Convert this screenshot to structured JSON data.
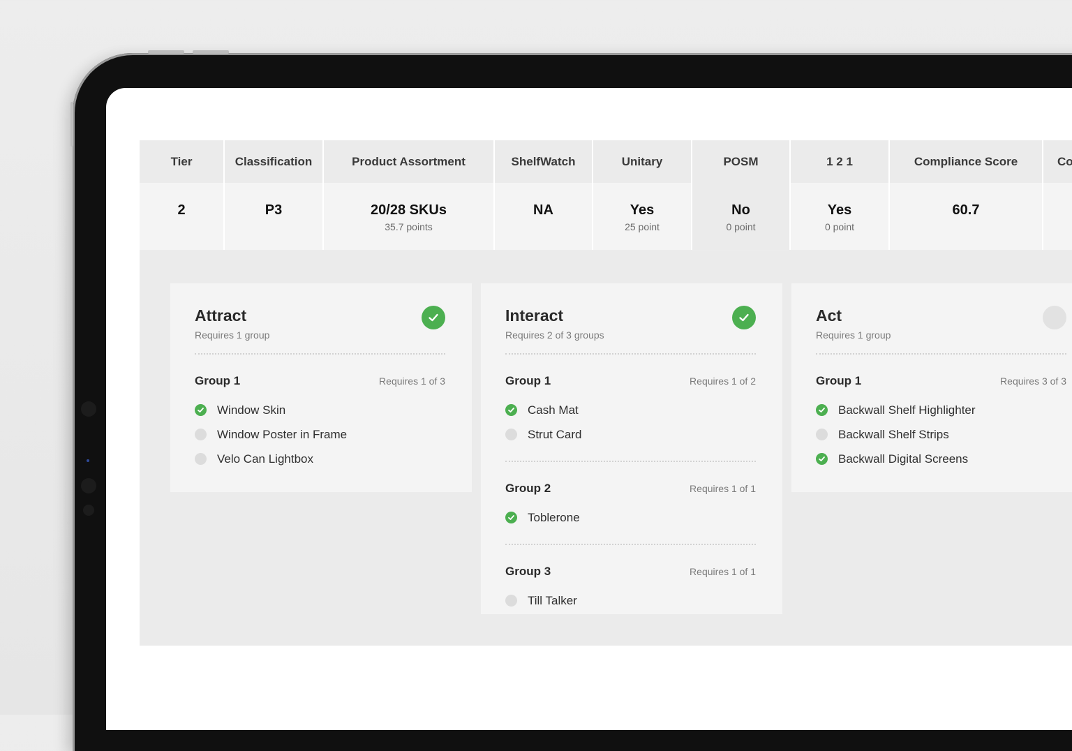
{
  "summary": {
    "headers": [
      "Tier",
      "Classification",
      "Product Assortment",
      "ShelfWatch",
      "Unitary",
      "POSM",
      "1 2 1",
      "Compliance Score",
      "Co"
    ],
    "values": [
      {
        "main": "2",
        "sub": ""
      },
      {
        "main": "P3",
        "sub": ""
      },
      {
        "main": "20/28 SKUs",
        "sub": "35.7 points"
      },
      {
        "main": "NA",
        "sub": ""
      },
      {
        "main": "Yes",
        "sub": "25 point"
      },
      {
        "main": "No",
        "sub": "0 point"
      },
      {
        "main": "Yes",
        "sub": "0 point"
      },
      {
        "main": "60.7",
        "sub": ""
      },
      {
        "main": "",
        "sub": ""
      }
    ],
    "active_column": "POSM"
  },
  "cards": {
    "attract": {
      "title": "Attract",
      "subtitle": "Requires 1 group",
      "status": "complete",
      "groups": [
        {
          "title": "Group 1",
          "requirement": "Requires 1 of 3",
          "items": [
            {
              "label": "Window Skin",
              "done": true
            },
            {
              "label": "Window Poster in Frame",
              "done": false
            },
            {
              "label": "Velo Can Lightbox",
              "done": false
            }
          ]
        }
      ]
    },
    "interact": {
      "title": "Interact",
      "subtitle": "Requires 2 of 3 groups",
      "status": "complete",
      "groups": [
        {
          "title": "Group 1",
          "requirement": "Requires 1 of 2",
          "items": [
            {
              "label": "Cash Mat",
              "done": true
            },
            {
              "label": "Strut Card",
              "done": false
            }
          ]
        },
        {
          "title": "Group 2",
          "requirement": "Requires 1 of 1",
          "items": [
            {
              "label": "Toblerone",
              "done": true
            }
          ]
        },
        {
          "title": "Group 3",
          "requirement": "Requires 1 of 1",
          "items": [
            {
              "label": "Till Talker",
              "done": false
            }
          ]
        }
      ]
    },
    "act": {
      "title": "Act",
      "subtitle": "Requires 1 group",
      "status": "incomplete",
      "groups": [
        {
          "title": "Group 1",
          "requirement": "Requires 3 of 3",
          "items": [
            {
              "label": "Backwall Shelf Highlighter",
              "done": true
            },
            {
              "label": "Backwall Shelf Strips",
              "done": false
            },
            {
              "label": "Backwall Digital Screens",
              "done": true
            }
          ]
        }
      ]
    }
  },
  "colors": {
    "success": "#4caf50",
    "pending": "#dcdcdc",
    "header_bg": "#ebebeb",
    "card_bg": "#f4f4f4"
  },
  "icons": {
    "status_complete": "check-circle-icon",
    "status_incomplete": "empty-circle-icon",
    "item_done": "check-dot-icon",
    "item_pending": "grey-dot-icon"
  }
}
